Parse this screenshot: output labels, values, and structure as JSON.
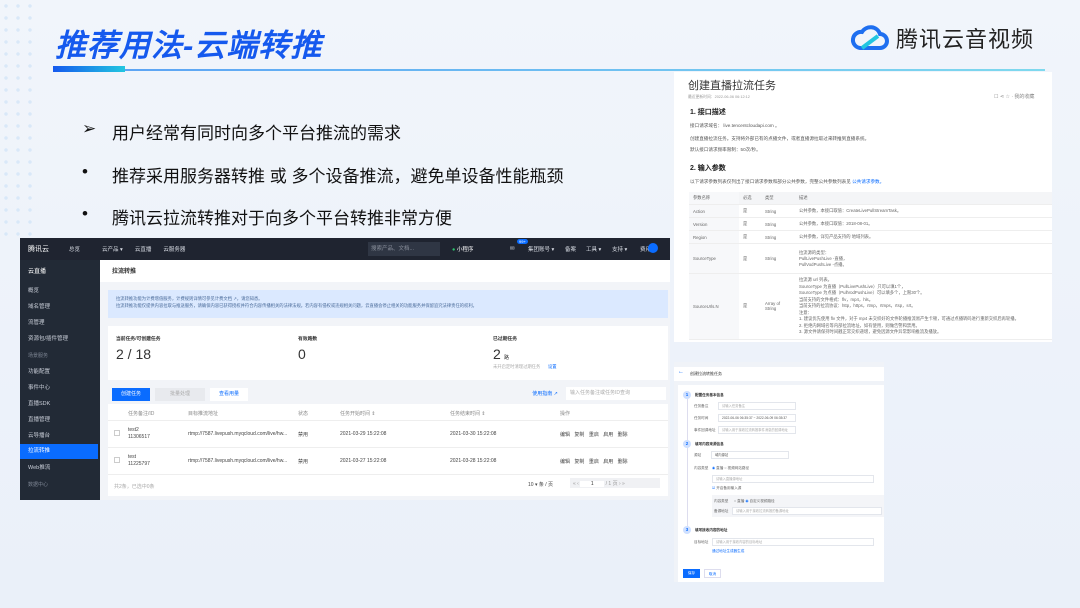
{
  "slide": {
    "title": "推荐用法-云端转推",
    "brand": "腾讯云音视频",
    "bullets": [
      {
        "marker": "➢",
        "text": "用户经常有同时向多个平台推流的需求"
      },
      {
        "marker": "•",
        "text": "推荐采用服务器转推 或 多个设备推流，避免单设备性能瓶颈"
      },
      {
        "marker": "•",
        "text": "腾讯云拉流转推对于向多个平台转推非常方便"
      }
    ]
  },
  "console": {
    "nav": {
      "brand": "腾讯云",
      "home": "总览",
      "products": "云产品 ▾",
      "live": "云直播",
      "cvm": "云服务器",
      "search_placeholder": "搜索产品、文档...",
      "mini": "小程序",
      "badge": "99+",
      "account": "集团账号 ▾",
      "record": "备案",
      "tools": "工具 ▾",
      "support": "支持 ▾",
      "billing": "费用 ▾"
    },
    "sidebar": {
      "title": "云直播",
      "items": [
        "概览",
        "域名管理",
        "流管理",
        "资源包/插件管理"
      ],
      "group1": "场景服务",
      "items2": [
        "功能配置",
        "事件中心",
        "直播SDK",
        "直播管理",
        "云导播台",
        "拉流转推",
        "Web推流"
      ],
      "group2": "数据中心"
    },
    "page_title": "拉流转推",
    "notice": [
      "拉流转推功能为计费增值服务，计费规则详情可参见计费文档 ↗，请您知悉。",
      "拉流转推功能仅提供内容拉取与推送服务，请确保内容已获得授权并符合内容传播相关的法律法规。若内容有侵权或违规相关问题，云直播会停止相关的功能服务并保留追究法律责任的权利。"
    ],
    "stats": [
      {
        "label": "当前任务/可创建任务",
        "value": "2 / 18"
      },
      {
        "label": "有效路数",
        "value": "0"
      },
      {
        "label": "已过期任务",
        "value": "2",
        "unit": "路",
        "note": "未开启定时清理过期任务",
        "link": "设置"
      }
    ],
    "toolbar": {
      "create": "创建任务",
      "batch": "批量处理",
      "view_usage": "查看用量",
      "guide": "使用指南 ↗",
      "search_placeholder": "输入任务备注或任务ID查询"
    },
    "columns": [
      "任务备注/ID",
      "目标推流地址",
      "状态",
      "任务开始时间 ⇕",
      "任务结束时间 ⇕",
      "操作"
    ],
    "rows": [
      {
        "name": "test2",
        "id": "11306517",
        "url": "rtmp://7587.livepush.myqcloud.com/live/hw...",
        "status": "禁用",
        "start": "2021-03-29 15:22:08",
        "end": "2021-03-30 15:22:08"
      },
      {
        "name": "test",
        "id": "11225797",
        "url": "rtmp://7587.livepush.myqcloud.com/live/hw...",
        "status": "禁用",
        "start": "2021-03-27 15:22:08",
        "end": "2021-03-28 15:22:08"
      }
    ],
    "actions": [
      "编辑",
      "复制",
      "重启",
      "启用",
      "删除"
    ],
    "footer": {
      "summary": "共2条，已选中0条",
      "page_size": "10 ▾ 条 / 页",
      "page": "1",
      "total_pages": "/ 1 页"
    }
  },
  "doc": {
    "title": "创建直播拉流任务",
    "updated": "最近更新时间：2022-06-06 06:12:12",
    "feedback": "我的收藏",
    "s1": "1. 接口描述",
    "p1": "接口请求域名： live.tencentcloudapi.com 。",
    "p2": "创建直播拉流任务。支持将外部已有的点播文件，或者直播源拉取过来转推到直播系统。",
    "p3": "默认接口请求频率限制：50次/秒。",
    "s2": "2. 输入参数",
    "p4": "以下请求参数列表仅列出了接口请求参数和部分公共参数，完整公共参数列表见",
    "p4link": "公共请求参数。",
    "headers": [
      "参数名称",
      "必选",
      "类型",
      "描述"
    ],
    "rows": [
      {
        "name": "Action",
        "req": "是",
        "type": "String",
        "desc": [
          "公共参数，本接口取值：CreateLivePullStreamTask。"
        ]
      },
      {
        "name": "Version",
        "req": "是",
        "type": "String",
        "desc": [
          "公共参数，本接口取值：2018-08-01。"
        ]
      },
      {
        "name": "Region",
        "req": "是",
        "type": "String",
        "desc": [
          "公共参数，详见产品支持的 地域列表。"
        ]
      },
      {
        "name": "SourceType",
        "req": "是",
        "type": "String",
        "desc": [
          "拉流源的类型：",
          "PullLivePushLive -直播，",
          "PullVodPushLive -点播。"
        ]
      },
      {
        "name": "SourceUrls.N",
        "req": "是",
        "type": "Array of String",
        "desc": [
          "拉流源 url 列表。",
          "SourceType 为直播（PullLivePushLive）只可以填1个，",
          "SourceType 为点播（PullVodPushLive）可以填多个，上限30个。",
          "当前支持的文件格式：flv，mp4，hls。",
          "当前支持的拉流协议：http，https，rtmp，rtmps，rtsp，srt。",
          "注意：",
          "1. 建议优先使用 flv 文件，对于 mp4 未交织好的文件轮播推流易产生卡顿，可通过点播转码进行重新交织后再轮播。",
          "2. 拒绝内网域名等内部拉流地址，如有使用，则做告警和禁用。",
          "3. 源文件请保持时间戳正常交织递增，避免因源文件异常影响推流及播放。"
        ]
      }
    ]
  },
  "form": {
    "back": "←",
    "title": "创建拉流转推任务",
    "step1": "配置任务基本信息",
    "f_note": "任务备注",
    "p_note": "请输入任务备注",
    "f_time": "任务时间",
    "v_time": "2022-06-06 06:35:37 ~ 2022-06-09 06:35:37",
    "f_cb": "事件回调地址",
    "p_cb": "请输入用于接收拉流转推事件消息的回调地址",
    "step2": "填写内容来源信息",
    "f_src": "源站",
    "v_src": "域内源站",
    "f_type": "内容类型",
    "r_live": "直播",
    "r_vod": "视频网站路径",
    "p_url": "请输入直播源地址",
    "cb_backup": "开启备用输入源",
    "f_type2": "内容类型",
    "r_live2": "直播",
    "r_vod2": "自定义视频路径",
    "f_addr": "备源地址",
    "p_addr": "请输入用于接收拉流转推的备源地址",
    "step3": "填写接收内容的地址",
    "f_dst": "目标地址",
    "p_dst": "请输入用于接收内容的目标地址",
    "gen": "通过地址生成器生成",
    "submit": "保存",
    "cancel": "取消"
  }
}
